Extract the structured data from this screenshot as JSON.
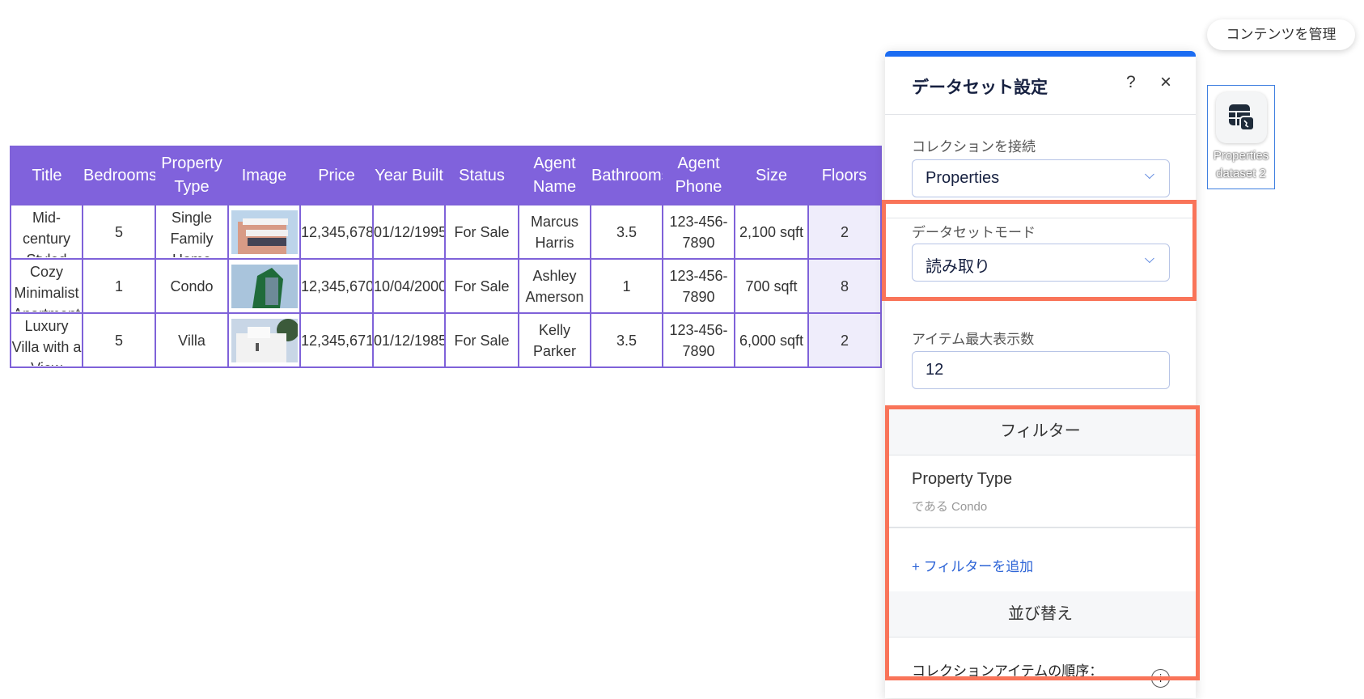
{
  "table": {
    "columns": [
      "Title",
      "Bedrooms",
      "Property Type",
      "Image",
      "Price",
      "Year Built",
      "Status",
      "Agent Name",
      "Bathrooms",
      "Agent Phone",
      "Size",
      "Floors"
    ],
    "rows": [
      {
        "title": "Mid-century Styled Home",
        "bedrooms": "5",
        "type": "Single Family Home",
        "image": "modern-house-photo",
        "price": "12,345,678",
        "year": "01/12/1995",
        "status": "For Sale",
        "agent": "Marcus Harris",
        "bathrooms": "3.5",
        "phone": "123-456-7890",
        "size": "2,100 sqft",
        "floors": "2"
      },
      {
        "title": "Cozy Minimalist Apartment",
        "bedrooms": "1",
        "type": "Condo",
        "image": "green-tower-photo",
        "price": "12,345,670",
        "year": "10/04/2000",
        "status": "For Sale",
        "agent": "Ashley Amerson",
        "bathrooms": "1",
        "phone": "123-456-7890",
        "size": "700 sqft",
        "floors": "8"
      },
      {
        "title": "Luxury Villa with a View",
        "bedrooms": "5",
        "type": "Villa",
        "image": "white-villa-photo",
        "price": "12,345,671",
        "year": "01/12/1985",
        "status": "For Sale",
        "agent": "Kelly Parker",
        "bathrooms": "3.5",
        "phone": "123-456-7890",
        "size": "6,000 sqft",
        "floors": "2"
      }
    ]
  },
  "manage_content": "コンテンツを管理",
  "dataset_icon": {
    "icon": "table-connect-icon",
    "label": "Properties dataset 2"
  },
  "panel": {
    "title": "データセット設定",
    "help": "?",
    "close": "×",
    "collection_label": "コレクションを接続",
    "collection_value": "Properties",
    "mode_label": "データセットモード",
    "mode_value": "読み取り",
    "max_label": "アイテム最大表示数",
    "max_value": "12",
    "filter_header": "フィルター",
    "filter_field": "Property Type",
    "filter_condition": "である Condo",
    "add_filter": "+ フィルターを追加",
    "sort_header": "並び替え",
    "sort_label": "コレクションアイテムの順序：",
    "chevron": "⌄"
  },
  "colors": {
    "header": "#8062dc",
    "accent": "#1b6cf2",
    "highlight": "#f97459",
    "link": "#2c63d6"
  }
}
